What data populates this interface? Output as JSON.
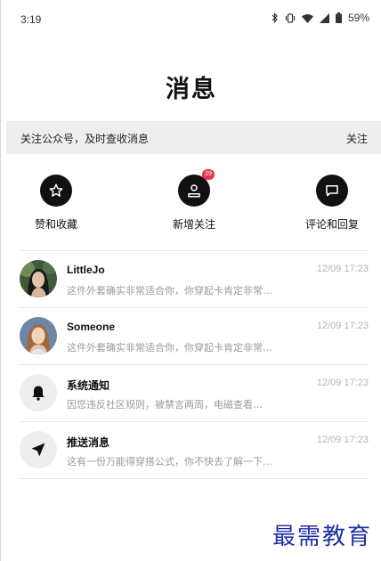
{
  "status_bar": {
    "time": "3:19",
    "battery": "59%"
  },
  "page": {
    "title": "消息"
  },
  "banner": {
    "text": "关注公众号，及时查收消息",
    "action_label": "关注"
  },
  "quick_actions": [
    {
      "label": "赞和收藏",
      "icon": "star-icon"
    },
    {
      "label": "新增关注",
      "icon": "person-icon",
      "badge": "29"
    },
    {
      "label": "评论和回复",
      "icon": "comment-icon"
    }
  ],
  "messages": [
    {
      "name": "LittleJo",
      "preview": "这件外套确实非常适合你，你穿起卡肯定非常…",
      "time": "12/09 17:23",
      "avatar": "photo"
    },
    {
      "name": "Someone",
      "preview": "这件外套确实非常适合你，你穿起卡肯定非常…",
      "time": "12/09 17:23",
      "avatar": "photo"
    },
    {
      "name": "系统通知",
      "preview": "因您违反社区规则，被禁言两周，电磁查看…",
      "time": "12/09 17:23",
      "avatar": "bell-icon"
    },
    {
      "name": "推送消息",
      "preview": "这有一份万能得穿搭公式，你不快去了解一下…",
      "time": "12/09 17:23",
      "avatar": "send-icon"
    }
  ],
  "watermark": "最需教育"
}
